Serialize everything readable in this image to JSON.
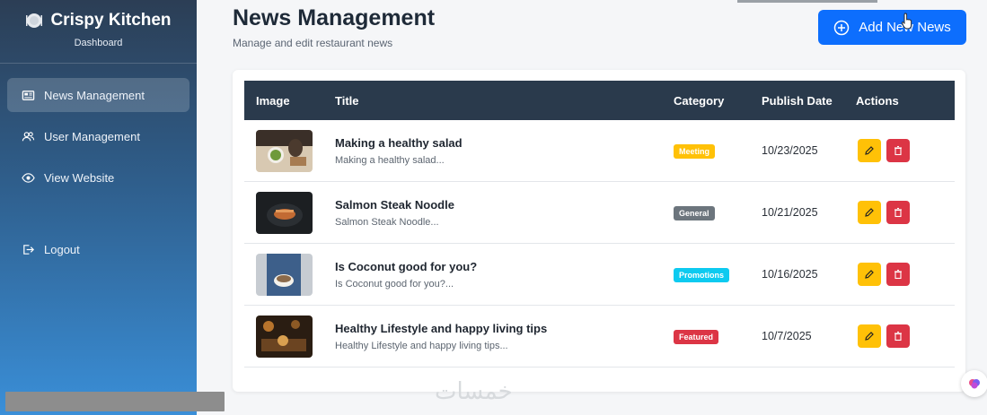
{
  "sidebar": {
    "brand_name": "Crispy Kitchen",
    "brand_subtitle": "Dashboard",
    "items": [
      {
        "label": "News Management",
        "icon": "newspaper-icon",
        "active": true
      },
      {
        "label": "User Management",
        "icon": "users-icon",
        "active": false
      },
      {
        "label": "View Website",
        "icon": "eye-icon",
        "active": false
      },
      {
        "label": "Logout",
        "icon": "logout-icon",
        "active": false
      }
    ]
  },
  "header": {
    "title": "News Management",
    "subtitle": "Manage and edit restaurant news",
    "add_button_label": "Add New News"
  },
  "table": {
    "columns": [
      "Image",
      "Title",
      "Category",
      "Publish Date",
      "Actions"
    ],
    "rows": [
      {
        "title": "Making a healthy salad",
        "excerpt": "Making a healthy salad...",
        "category": "Meeting",
        "category_color": "#ffc107",
        "date": "10/23/2025"
      },
      {
        "title": "Salmon Steak Noodle",
        "excerpt": "Salmon Steak Noodle...",
        "category": "General",
        "category_color": "#6c757d",
        "date": "10/21/2025"
      },
      {
        "title": "Is Coconut good for you?",
        "excerpt": "Is Coconut good for you?...",
        "category": "Promotions",
        "category_color": "#0dcaf0",
        "date": "10/16/2025"
      },
      {
        "title": "Healthy Lifestyle and happy living tips",
        "excerpt": "Healthy Lifestyle and happy living tips...",
        "category": "Featured",
        "category_color": "#dc3545",
        "date": "10/7/2025"
      }
    ]
  },
  "watermark": "خمسات",
  "colors": {
    "primary": "#0d6efd",
    "table_header": "#2a3a4c",
    "edit": "#ffc107",
    "delete": "#dc3545"
  }
}
